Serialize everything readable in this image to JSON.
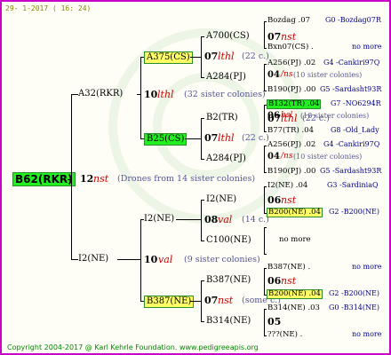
{
  "header": {
    "date": "29- 1-2017 ( 16: 24)"
  },
  "footer": {
    "copyright": "Copyright 2004-2017 @ Karl Kehrle Foundation.   www.pedigreeapis.org"
  },
  "root": {
    "label": "B62(RKR)",
    "year": "12",
    "mark": "nst",
    "note": "(Drones from 14 sister colonies)"
  },
  "gen1": {
    "upper": {
      "label": "A32(RKR)",
      "year": "10",
      "mark": "lthl",
      "note": "(32 sister colonies)"
    },
    "lower": {
      "label": "I2(NE)",
      "year": "10",
      "mark": "val",
      "note": "(9 sister colonies)"
    }
  },
  "gen2": {
    "a375": {
      "label": "A375(CS)",
      "year": "07",
      "mark": "lthl",
      "note": "(22 c.)"
    },
    "b25": {
      "label": "B25(CS)",
      "year": "07",
      "mark": "lthl",
      "note": "(22 c.)"
    },
    "i2": {
      "label": "I2(NE)",
      "year": "08",
      "mark": "val",
      "note": "(14 c.)"
    },
    "b387": {
      "label": "B387(NE)",
      "year": "07",
      "mark": "nst",
      "note": "(some c.)"
    }
  },
  "gen3": {
    "a700": {
      "label": "A700(CS)",
      "year": "07",
      "mark": "nst"
    },
    "a284a": {
      "label": "A284(PJ)"
    },
    "b2": {
      "label": "B2(TR)",
      "year": "07",
      "mark": "lthl",
      "note": "(22 c.)"
    },
    "a284b": {
      "label": "A284(PJ)"
    },
    "i2ne": {
      "label": "I2(NE)",
      "year": "06",
      "mark": "nst"
    },
    "c100": {
      "label": "C100(NE)"
    },
    "b387ne": {
      "label": "B387(NE)",
      "year": "06",
      "mark": "nst"
    },
    "b314": {
      "label": "B314(NE)",
      "year": "05"
    }
  },
  "gen4": {
    "r1": {
      "label": "Bozdag .07",
      "code": "G0 -Bozdag07R"
    },
    "r2": {
      "label": "Bxn07(CS) .",
      "code": "no more"
    },
    "r3": {
      "label": "A256(PJ) .02",
      "code": "G4 -Cankiri97Q"
    },
    "r3b": {
      "year": "04",
      "mark": "/ns",
      "note": "(10 sister colonies)"
    },
    "r4": {
      "label": "B190(PJ) .00",
      "code": "G5 -Sardasht93R"
    },
    "r5": {
      "label": "B132(TR) .04",
      "code": "G7 -NO6294R"
    },
    "r5b": {
      "year": "06",
      "mark": "bsl",
      "note": "(18 sister colonies)"
    },
    "r6": {
      "label": "B77(TR) .04",
      "code": "G8 -Old_Lady"
    },
    "r7": {
      "label": "A256(PJ) .02",
      "code": "G4 -Cankiri97Q"
    },
    "r7b": {
      "year": "04",
      "mark": "/ns",
      "note": "(10 sister colonies)"
    },
    "r8": {
      "label": "B190(PJ) .00",
      "code": "G5 -Sardasht93R"
    },
    "r9": {
      "label": "I2(NE) .04",
      "code": "G3 -SardiniaQ"
    },
    "r10": {
      "label": "B200(NE) .04",
      "code": "G2 -B200(NE)"
    },
    "r11": {
      "label": "no more"
    },
    "r12": {
      "label": "B387(NE) .",
      "code": "no more"
    },
    "r13": {
      "label": "B200(NE) .04",
      "code": "G2 -B200(NE)"
    },
    "r14": {
      "label": "B314(NE) .03",
      "code": "G0 -B314(NE)"
    },
    "r15": {
      "label": "???(NE) .",
      "code": "no more"
    }
  }
}
